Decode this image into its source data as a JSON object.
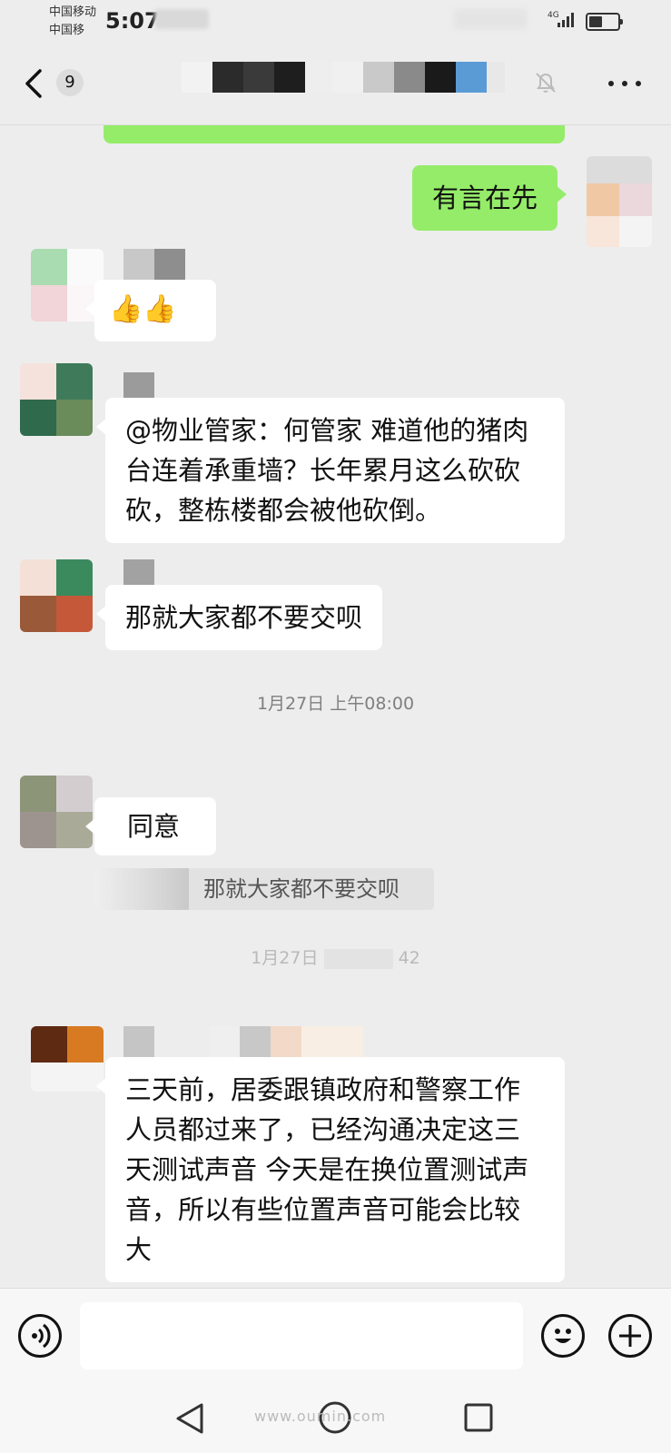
{
  "status_bar": {
    "carrier_1": "中国移动",
    "carrier_2": "中国移",
    "time": "5:07",
    "network": "4G"
  },
  "title_bar": {
    "unread_count": "9"
  },
  "messages": {
    "partial_top": "……",
    "me_1": "有言在先",
    "reply_1_emoji": "👍👍",
    "reply_2": "@物业管家：何管家  难道他的猪肉台连着承重墙？长年累月这么砍砍砍，整栋楼都会被他砍倒。",
    "reply_3": "那就大家都不要交呗",
    "timestamp_1": "1月27日 上午08:00",
    "reply_4": "同意",
    "reply_4_quote": "那就大家都不要交呗",
    "timestamp_2": "1月27日",
    "timestamp_2_tail": "42",
    "reply_5": "三天前，居委跟镇政府和警察工作人员都过来了，已经沟通决定这三天测试声音  今天是在换位置测试声音，所以有些位置声音可能会比较大"
  },
  "input_bar": {
    "placeholder": ""
  },
  "watermark": "www.oumin.com"
}
